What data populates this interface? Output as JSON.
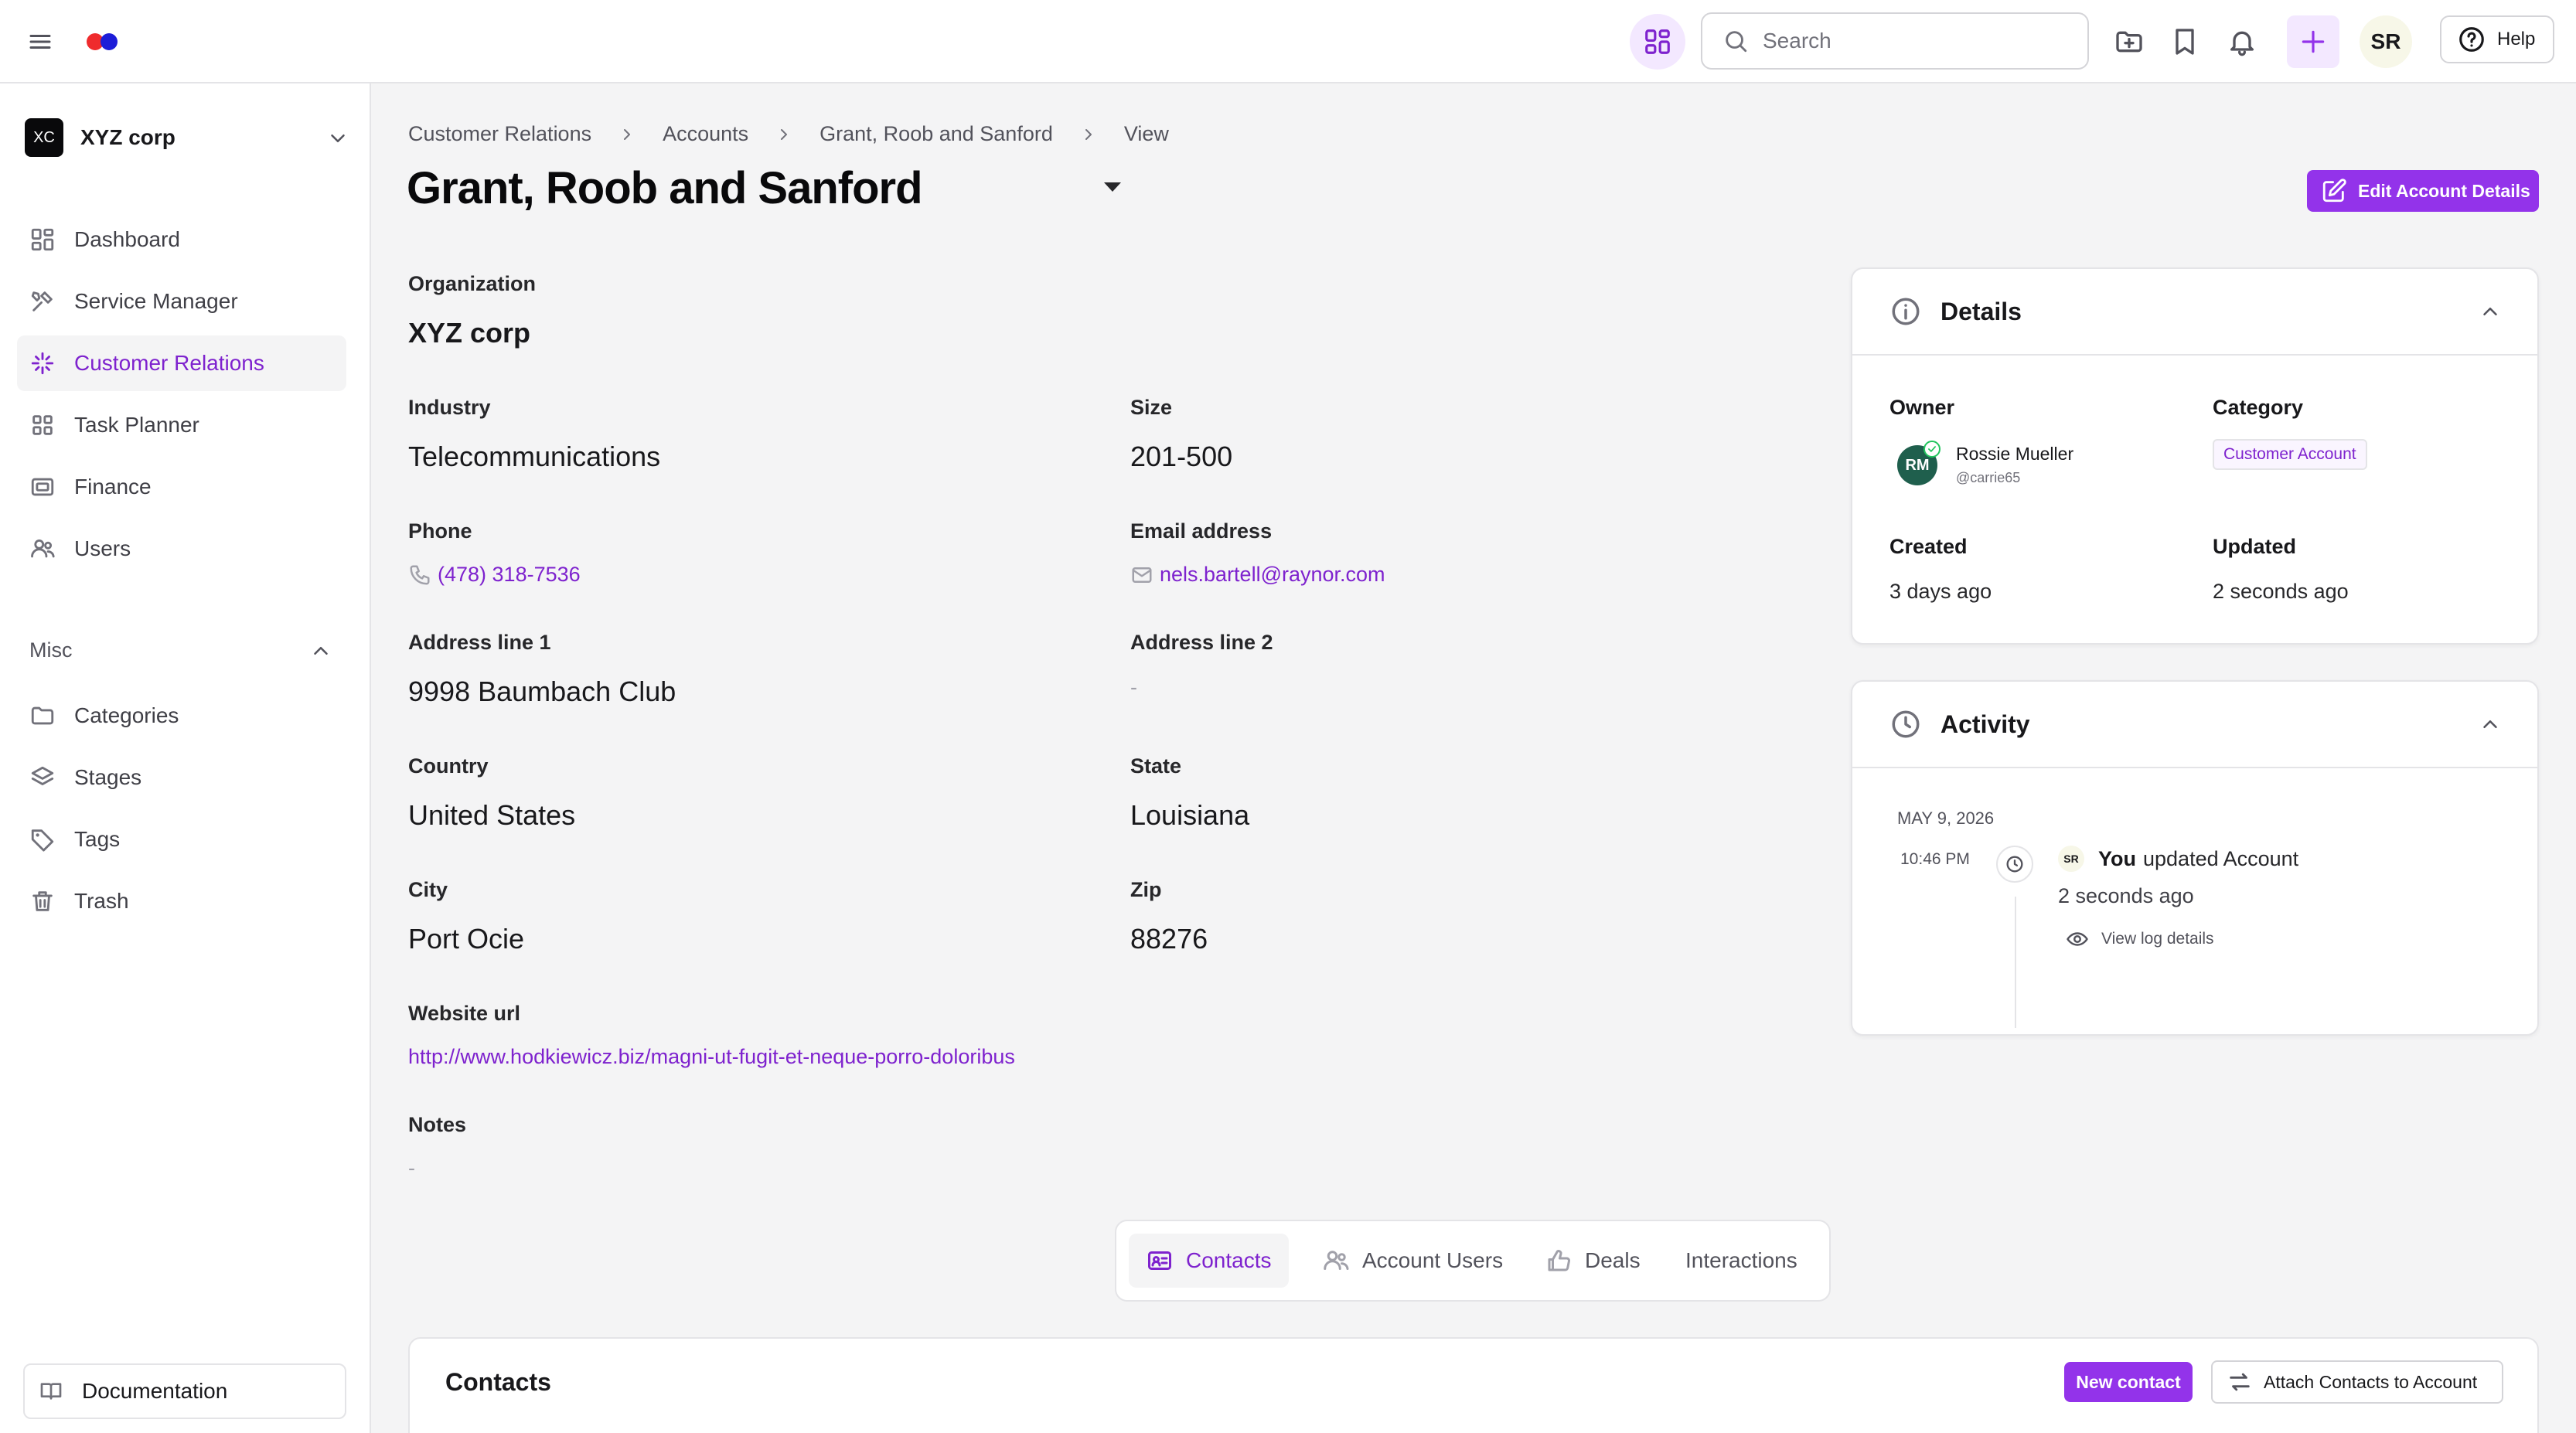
{
  "app": {
    "search_placeholder": "Search",
    "user_initials": "SR",
    "help_label": "Help",
    "accent_color": "#9333ea"
  },
  "sidebar": {
    "org_badge": "XC",
    "org_name": "XYZ corp",
    "nav": [
      {
        "label": "Dashboard",
        "icon": "dashboard-icon"
      },
      {
        "label": "Service Manager",
        "icon": "tools-icon"
      },
      {
        "label": "Customer Relations",
        "icon": "sparkle-icon",
        "active": true
      },
      {
        "label": "Task Planner",
        "icon": "grid-icon"
      },
      {
        "label": "Finance",
        "icon": "finance-icon"
      },
      {
        "label": "Users",
        "icon": "users-icon"
      }
    ],
    "misc_label": "Misc",
    "misc": [
      {
        "label": "Categories",
        "icon": "folder-icon"
      },
      {
        "label": "Stages",
        "icon": "layers-icon"
      },
      {
        "label": "Tags",
        "icon": "tag-icon"
      },
      {
        "label": "Trash",
        "icon": "trash-icon"
      }
    ],
    "documentation_label": "Documentation"
  },
  "breadcrumb": [
    "Customer Relations",
    "Accounts",
    "Grant, Roob and Sanford",
    "View"
  ],
  "page": {
    "title": "Grant, Roob and Sanford",
    "edit_button": "Edit Account Details"
  },
  "account": {
    "organization_label": "Organization",
    "organization": "XYZ corp",
    "industry_label": "Industry",
    "industry": "Telecommunications",
    "size_label": "Size",
    "size": "201-500",
    "phone_label": "Phone",
    "phone": "(478) 318-7536",
    "email_label": "Email address",
    "email": "nels.bartell@raynor.com",
    "address1_label": "Address line 1",
    "address1": "9998 Baumbach Club",
    "address2_label": "Address line 2",
    "address2": "-",
    "country_label": "Country",
    "country": "United States",
    "state_label": "State",
    "state": "Louisiana",
    "city_label": "City",
    "city": "Port Ocie",
    "zip_label": "Zip",
    "zip": "88276",
    "website_label": "Website url",
    "website": "http://www.hodkiewicz.biz/magni-ut-fugit-et-neque-porro-doloribus",
    "notes_label": "Notes",
    "notes": "-"
  },
  "details": {
    "title": "Details",
    "owner_label": "Owner",
    "owner_initials": "RM",
    "owner_name": "Rossie Mueller",
    "owner_handle": "@carrie65",
    "category_label": "Category",
    "category": "Customer Account",
    "created_label": "Created",
    "created": "3 days ago",
    "updated_label": "Updated",
    "updated": "2 seconds ago"
  },
  "activity": {
    "title": "Activity",
    "date": "MAY 9, 2026",
    "time": "10:46 PM",
    "actor_initials": "SR",
    "actor": "You",
    "action": "updated Account",
    "ago": "2 seconds ago",
    "view_log": "View log details"
  },
  "tabs": [
    {
      "label": "Contacts",
      "icon": "contact-card-icon",
      "active": true
    },
    {
      "label": "Account Users",
      "icon": "users-icon"
    },
    {
      "label": "Deals",
      "icon": "thumbs-up-icon"
    },
    {
      "label": "Interactions",
      "icon": ""
    }
  ],
  "contacts": {
    "title": "Contacts",
    "new_button": "New contact",
    "attach_button": "Attach Contacts to Account"
  }
}
